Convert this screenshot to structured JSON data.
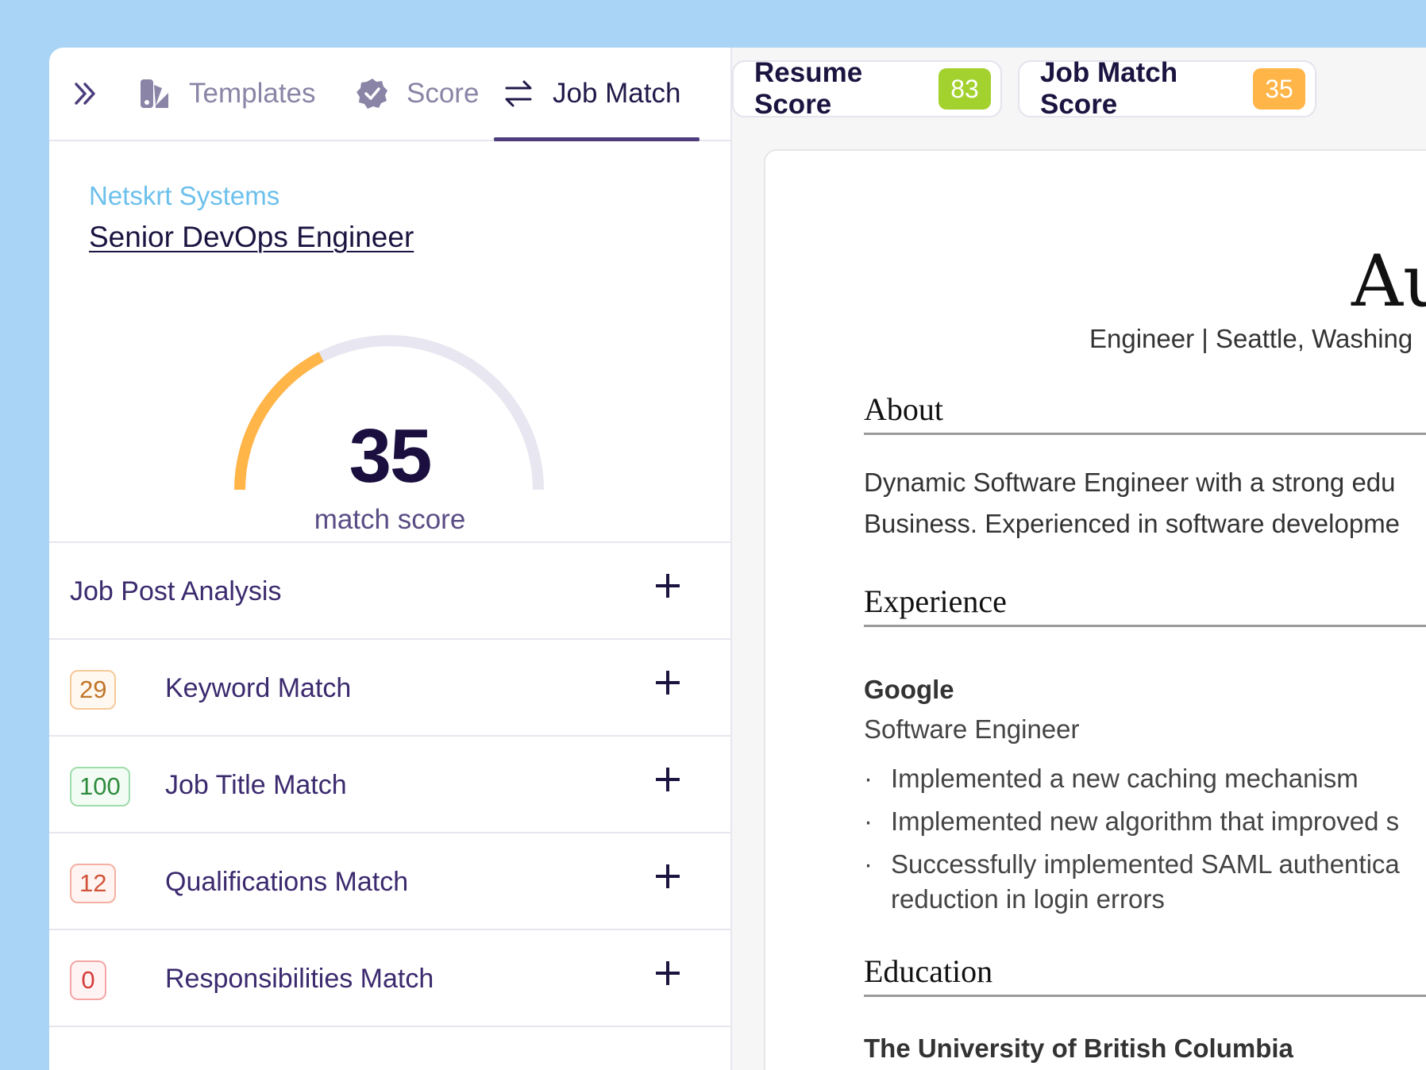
{
  "tabs": [
    {
      "label": "Templates",
      "icon": "templates-icon"
    },
    {
      "label": "Score",
      "icon": "score-badge-icon"
    },
    {
      "label": "Job Match",
      "icon": "swap-arrows-icon",
      "active": true
    }
  ],
  "job": {
    "company": "Netskrt Systems",
    "title": "Senior DevOps Engineer"
  },
  "gauge": {
    "value": "35",
    "label": "match score",
    "fraction": 0.35,
    "fill_color": "#ffb547",
    "track_color": "#e8e6f0"
  },
  "analysis": {
    "header": "Job Post Analysis",
    "items": [
      {
        "score": "29",
        "label": "Keyword Match",
        "color": "#c0752a",
        "border": "#f6c99a",
        "bg": "#fff8f0"
      },
      {
        "score": "100",
        "label": "Job Title Match",
        "color": "#2e8b3d",
        "border": "#9fdcac",
        "bg": "#f2fcf4"
      },
      {
        "score": "12",
        "label": "Qualifications Match",
        "color": "#d0533a",
        "border": "#f4b0a2",
        "bg": "#fff4f1"
      },
      {
        "score": "0",
        "label": "Responsibilities Match",
        "color": "#d63a3a",
        "border": "#f4a6a6",
        "bg": "#fff3f3"
      }
    ]
  },
  "scores": {
    "resume_label": "Resume Score",
    "resume_value": "83",
    "resume_color": "#a3d12e",
    "jobmatch_label": "Job Match Score",
    "jobmatch_value": "35",
    "jobmatch_color": "#ffb547"
  },
  "resume": {
    "name": "Au",
    "subline": "Engineer  |  Seattle, Washing",
    "about_heading": "About",
    "about_lines": [
      "Dynamic Software Engineer with a strong edu",
      "Business. Experienced in software developme"
    ],
    "experience_heading": "Experience",
    "company": "Google",
    "role": "Software Engineer",
    "bullets": [
      "Implemented a new caching mechanism",
      "Implemented new algorithm that improved s",
      "Successfully implemented SAML authentica",
      "reduction in login errors"
    ],
    "education_heading": "Education",
    "school": "The University of British Columbia"
  }
}
